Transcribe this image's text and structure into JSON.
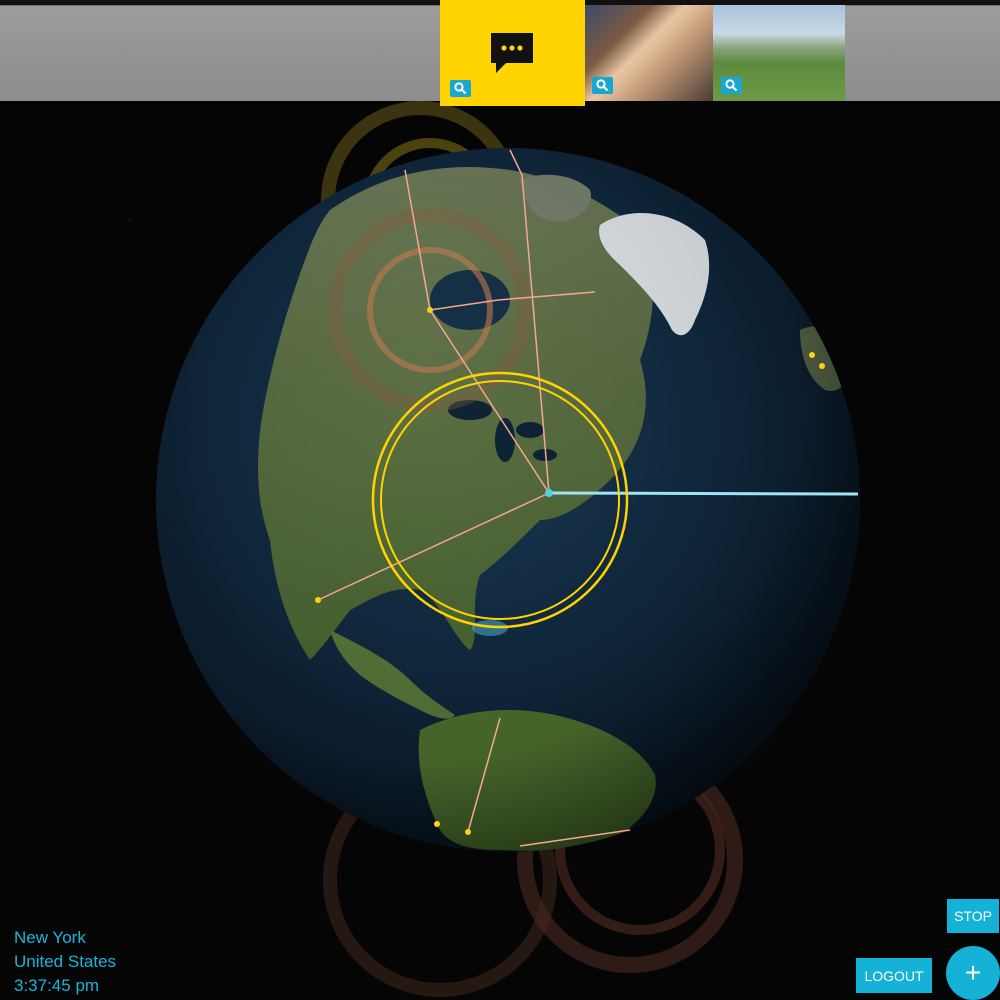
{
  "gallery": {
    "tiles": [
      {
        "kind": "chat",
        "icon": "chat-bubble-icon",
        "zoom_icon": "magnify-icon"
      },
      {
        "kind": "photo",
        "zoom_icon": "magnify-icon"
      },
      {
        "kind": "photo",
        "zoom_icon": "magnify-icon"
      }
    ],
    "accent": "#ffd400"
  },
  "location": {
    "city": "New York",
    "country": "United States",
    "time": "3:37:45 pm"
  },
  "controls": {
    "stop_label": "STOP",
    "logout_label": "LOGOUT",
    "add_label": "+"
  },
  "colors": {
    "button": "#14b2d6",
    "readout": "#18b4dc",
    "ring": "#ffd400",
    "arc": "#f4a78f",
    "beam": "#9fe3f5"
  }
}
